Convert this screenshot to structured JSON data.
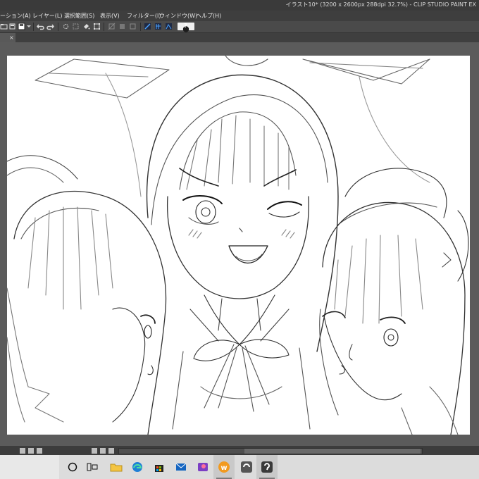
{
  "window": {
    "title": "イラスト10* (3200 x 2600px 288dpi 32.7%) - CLIP STUDIO PAINT EX"
  },
  "menu": {
    "items": [
      {
        "label": "ーション(A)"
      },
      {
        "label": "レイヤー(L)"
      },
      {
        "label": "選択範囲(S)"
      },
      {
        "label": "表示(V)"
      },
      {
        "label": "フィルター(I)"
      },
      {
        "label": "ウィンドウ(W)"
      },
      {
        "label": "ヘルプ(H)"
      }
    ]
  },
  "toolbar": {
    "help_label": "?",
    "icons": [
      "open-icon",
      "save-icon",
      "undo-icon",
      "redo-icon",
      "transform-icon",
      "select-all-icon",
      "fill-icon",
      "crop-icon",
      "ruler-icon",
      "snap-icon",
      "layer-icon",
      "color-icon"
    ]
  },
  "canvas": {
    "tab_close": "×",
    "content": "line sketch of three anime girls (one winking center, two side profiles)"
  },
  "taskbar": {
    "icons": [
      "cortana-icon",
      "task-view-icon",
      "file-explorer-icon",
      "edge-icon",
      "store-icon",
      "mail-icon",
      "photos-icon",
      "app-w-icon",
      "clip-studio-icon",
      "clip-studio-paint-icon"
    ]
  }
}
